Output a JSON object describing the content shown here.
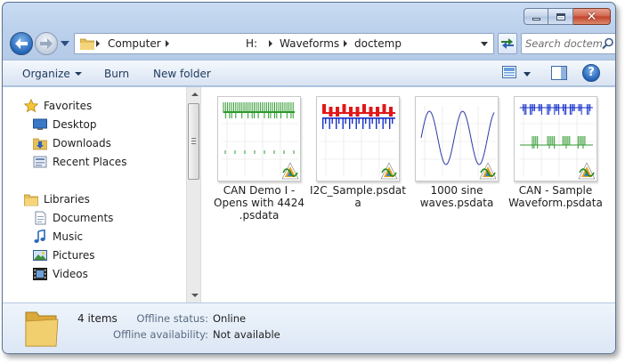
{
  "window": {
    "minimize_icon": "minimize-icon",
    "maximize_icon": "maximize-icon",
    "close_icon": "close-icon",
    "close_glyph": "✕"
  },
  "address_bar": {
    "crumbs": [
      "Computer",
      "H:",
      "Waveforms",
      "doctemp"
    ],
    "refresh_icon": "refresh-icon"
  },
  "search": {
    "placeholder": "Search doctemp"
  },
  "toolbar": {
    "organize": "Organize",
    "burn": "Burn",
    "new_folder": "New folder",
    "help": "?"
  },
  "sidebar": {
    "favorites": {
      "title": "Favorites",
      "items": [
        "Desktop",
        "Downloads",
        "Recent Places"
      ]
    },
    "libraries": {
      "title": "Libraries",
      "items": [
        "Documents",
        "Music",
        "Pictures",
        "Videos"
      ]
    }
  },
  "files": [
    {
      "name": "CAN Demo I - Opens with 4424 .psdata"
    },
    {
      "name": "I2C_Sample.psdata"
    },
    {
      "name": "1000 sine waves.psdata"
    },
    {
      "name": "CAN - Sample Waveform.psdata"
    }
  ],
  "colors": {
    "green_trace": "#2e9a2e",
    "red_trace": "#e01818",
    "blue_trace": "#1530c8",
    "sine_trace": "#2a3aa8"
  },
  "details": {
    "count": "4 items",
    "offline_status_label": "Offline status:",
    "offline_status_value": "Online",
    "offline_avail_label": "Offline availability:",
    "offline_avail_value": "Not available"
  }
}
